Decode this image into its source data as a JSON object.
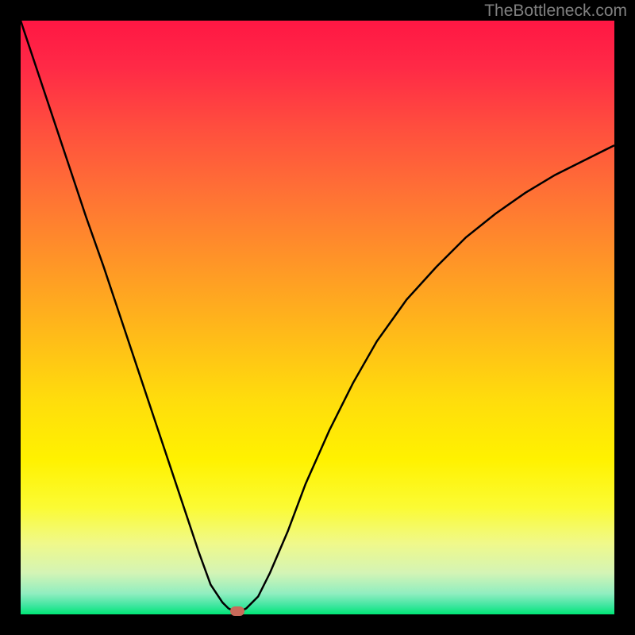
{
  "watermark": "TheBottleneck.com",
  "chart_data": {
    "type": "line",
    "title": "",
    "xlabel": "",
    "ylabel": "",
    "xlim": [
      0,
      100
    ],
    "ylim": [
      0,
      100
    ],
    "x": [
      0,
      2,
      5,
      8,
      11,
      14,
      17,
      20,
      23,
      26,
      28,
      30,
      32,
      34,
      35,
      36,
      37,
      38,
      40,
      42,
      45,
      48,
      52,
      56,
      60,
      65,
      70,
      75,
      80,
      85,
      90,
      95,
      100
    ],
    "values": [
      100,
      94,
      85,
      76,
      67,
      58.5,
      49.5,
      40.5,
      31.5,
      22.5,
      16.5,
      10.5,
      5,
      2,
      1,
      0.5,
      0.5,
      1,
      3,
      7,
      14,
      22,
      31,
      39,
      46,
      53,
      58.5,
      63.5,
      67.5,
      71,
      74,
      76.5,
      79
    ],
    "bottleneck_point": {
      "x": 36.5,
      "y": 0.5
    },
    "gradient_stops": [
      {
        "pos": 0.0,
        "color": "#ff1744"
      },
      {
        "pos": 0.08,
        "color": "#ff2a46"
      },
      {
        "pos": 0.18,
        "color": "#ff4e3e"
      },
      {
        "pos": 0.28,
        "color": "#ff6e36"
      },
      {
        "pos": 0.4,
        "color": "#ff9328"
      },
      {
        "pos": 0.52,
        "color": "#ffb81a"
      },
      {
        "pos": 0.64,
        "color": "#ffdd0c"
      },
      {
        "pos": 0.74,
        "color": "#fff200"
      },
      {
        "pos": 0.82,
        "color": "#fbfb34"
      },
      {
        "pos": 0.88,
        "color": "#f0f98a"
      },
      {
        "pos": 0.93,
        "color": "#d4f4b5"
      },
      {
        "pos": 0.965,
        "color": "#90eec0"
      },
      {
        "pos": 0.985,
        "color": "#40e6a0"
      },
      {
        "pos": 1.0,
        "color": "#00e676"
      }
    ]
  }
}
